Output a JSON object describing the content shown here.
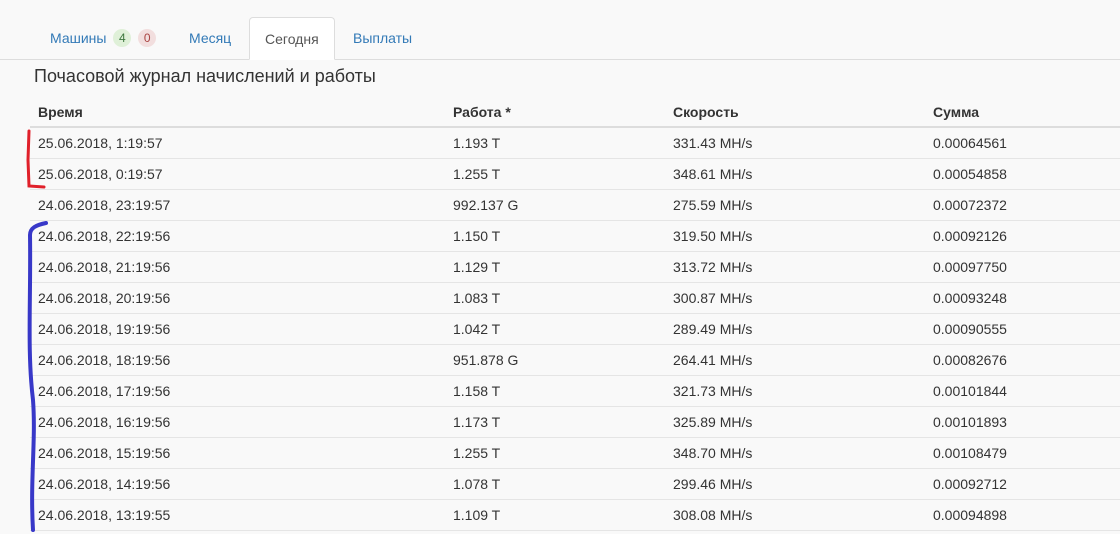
{
  "tabs": [
    {
      "label": "Машины",
      "badge_ok": "4",
      "badge_bad": "0"
    },
    {
      "label": "Месяц"
    },
    {
      "label": "Сегодня"
    },
    {
      "label": "Выплаты"
    }
  ],
  "title": "Почасовой журнал начислений и работы",
  "columns": [
    "Время",
    "Работа *",
    "Скорость",
    "Сумма"
  ],
  "rows": [
    [
      "25.06.2018, 1:19:57",
      "1.193 T",
      "331.43 MH/s",
      "0.00064561"
    ],
    [
      "25.06.2018, 0:19:57",
      "1.255 T",
      "348.61 MH/s",
      "0.00054858"
    ],
    [
      "24.06.2018, 23:19:57",
      "992.137 G",
      "275.59 MH/s",
      "0.00072372"
    ],
    [
      "24.06.2018, 22:19:56",
      "1.150 T",
      "319.50 MH/s",
      "0.00092126"
    ],
    [
      "24.06.2018, 21:19:56",
      "1.129 T",
      "313.72 MH/s",
      "0.00097750"
    ],
    [
      "24.06.2018, 20:19:56",
      "1.083 T",
      "300.87 MH/s",
      "0.00093248"
    ],
    [
      "24.06.2018, 19:19:56",
      "1.042 T",
      "289.49 MH/s",
      "0.00090555"
    ],
    [
      "24.06.2018, 18:19:56",
      "951.878 G",
      "264.41 MH/s",
      "0.00082676"
    ],
    [
      "24.06.2018, 17:19:56",
      "1.158 T",
      "321.73 MH/s",
      "0.00101844"
    ],
    [
      "24.06.2018, 16:19:56",
      "1.173 T",
      "325.89 MH/s",
      "0.00101893"
    ],
    [
      "24.06.2018, 15:19:56",
      "1.255 T",
      "348.70 MH/s",
      "0.00108479"
    ],
    [
      "24.06.2018, 14:19:56",
      "1.078 T",
      "299.46 MH/s",
      "0.00092712"
    ],
    [
      "24.06.2018, 13:19:55",
      "1.109 T",
      "308.08 MH/s",
      "0.00094898"
    ]
  ],
  "colors": {
    "link": "#337ab7",
    "red_mark": "#e0202a",
    "blue_mark": "#3838c8"
  }
}
